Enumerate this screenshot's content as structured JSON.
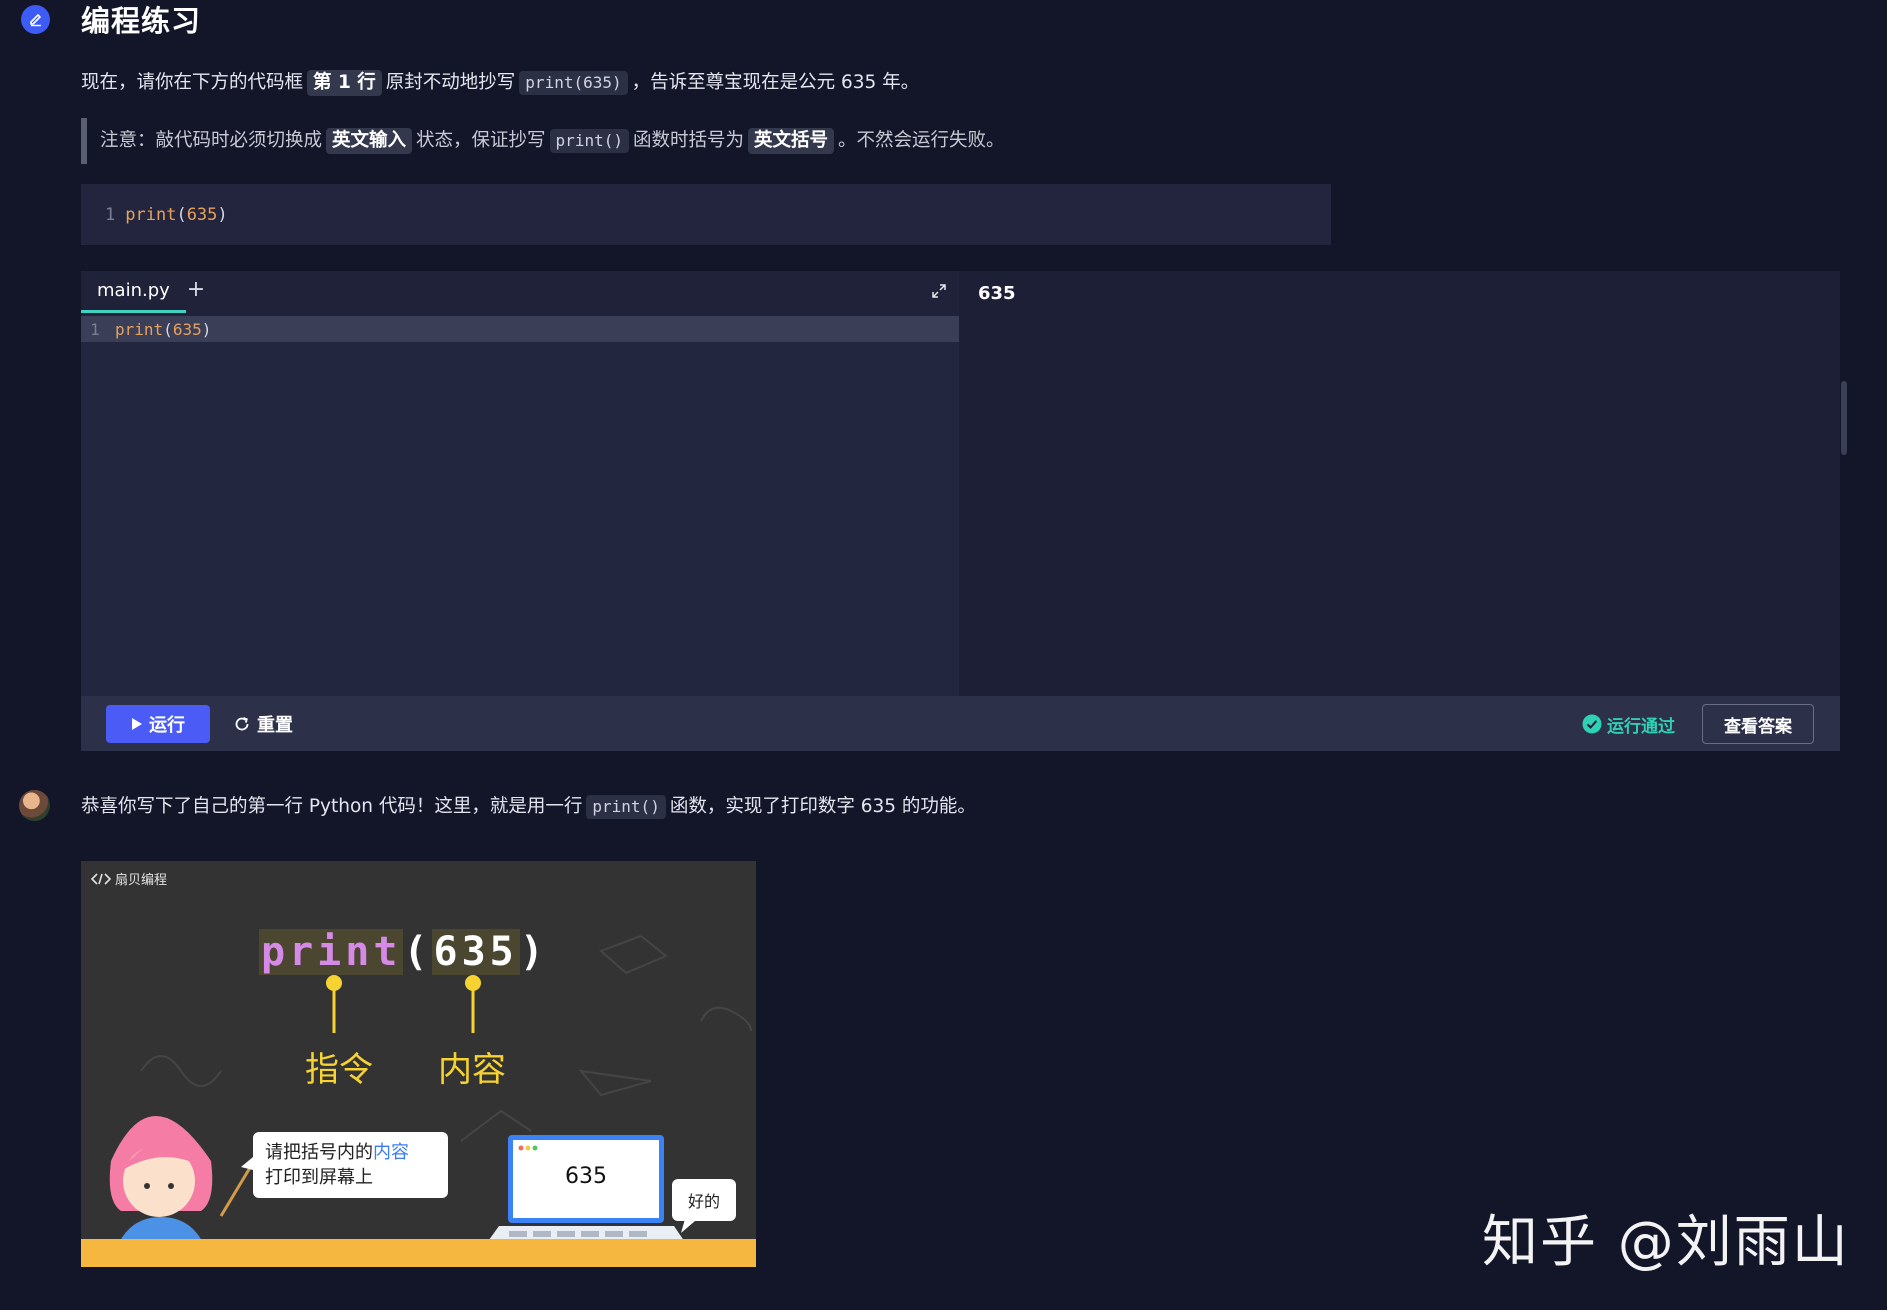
{
  "section": {
    "title": "编程练习",
    "icon": "edit-icon",
    "accent": "#3d5bf5"
  },
  "intro": {
    "part1": "现在，请你在下方的代码框",
    "tag": "第 1 行",
    "part2": "原封不动地抄写",
    "code": "print(635)",
    "part3": "，告诉至尊宝现在是公元 635 年。"
  },
  "note": {
    "part1": "注意：敲代码时必须切换成",
    "tag1": "英文输入",
    "part2": "状态，保证抄写",
    "code": "print()",
    "part3": "函数时括号为",
    "tag2": "英文括号",
    "part4": "。不然会运行失败。"
  },
  "snippet": {
    "line_number": "1",
    "keyword": "print",
    "open": "(",
    "arg": "635",
    "close": ")"
  },
  "ide": {
    "tab_label": "main.py",
    "add_tab": "+",
    "line_number": "1",
    "keyword": "print",
    "open": "(",
    "arg": "635",
    "close": ")",
    "output": "635",
    "run_label": "运行",
    "reset_label": "重置",
    "status_label": "运行通过",
    "answer_label": "查看答案",
    "status_color": "#2fd1b4",
    "run_color": "#4a5cf5"
  },
  "congrats": {
    "part1": "恭喜你写下了自己的第一行 Python 代码！这里，就是用一行",
    "code": "print()",
    "part2": "函数，实现了打印数字 635 的功能。"
  },
  "illustration": {
    "brand": "扇贝编程",
    "keyword": "print",
    "open": "(",
    "arg": "635",
    "close": ")",
    "label_command": "指令",
    "label_content": "内容",
    "bubble_left_line1_a": "请把括号内的",
    "bubble_left_line1_b": "内容",
    "bubble_left_line2": "打印到屏幕上",
    "screen_output": "635",
    "bubble_right": "好的"
  },
  "watermark": "知乎 @刘雨山"
}
